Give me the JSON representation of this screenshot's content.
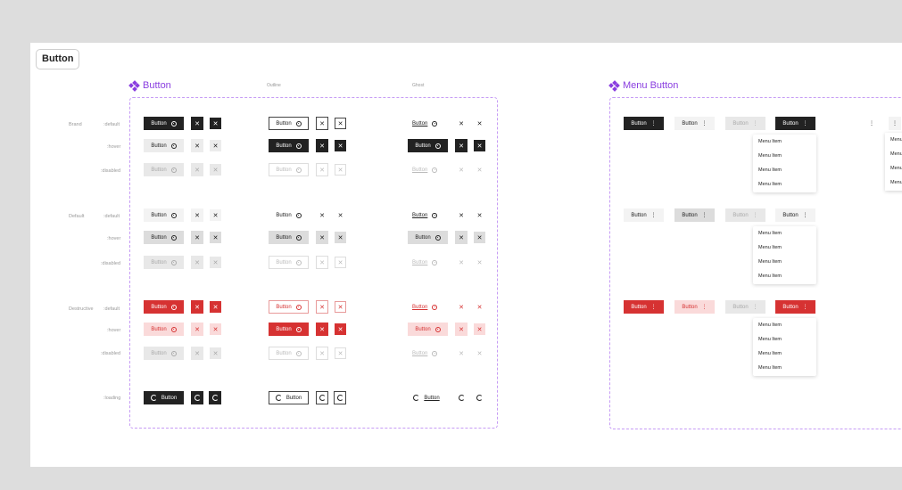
{
  "page": {
    "title": "Button"
  },
  "sections": {
    "button": {
      "title": "Button",
      "col_default": "Outline",
      "col_ghost": "Ghost"
    },
    "menu_button": {
      "title": "Menu Button"
    }
  },
  "row_labels": {
    "brand": "Brand",
    "default_group": "Default",
    "destructive": "Destructive",
    "state_default": ":default",
    "state_hover": ":hover",
    "state_disabled": ":disabled",
    "state_loading": ":loading"
  },
  "labels": {
    "button": "Button",
    "menu_item": "Menu Item",
    "menu_item_cut": "Menu",
    "close": "✕",
    "more": "⋮"
  },
  "colors": {
    "accent": "#8a3ee0",
    "primary": "#222222",
    "destructive": "#d63232"
  }
}
